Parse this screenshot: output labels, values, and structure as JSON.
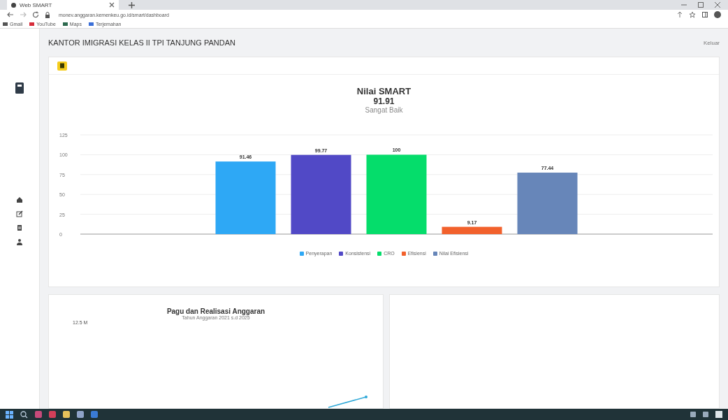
{
  "browser": {
    "tab_title": "Web SMART",
    "url": "monev.anggaran.kemenkeu.go.id/smart/dashboard",
    "bookmarks": [
      "Gmail",
      "YouTube",
      "Maps",
      "Terjemahan"
    ]
  },
  "header": {
    "title": "KANTOR IMIGRASI KELAS II TPI TANJUNG PANDAN",
    "user": "Keluar"
  },
  "smart_card": {
    "score": "91.91",
    "rating": "Sangat Baik",
    "chart_data": {
      "type": "bar",
      "title": "Nilai SMART",
      "ylim": [
        0,
        125
      ],
      "yticks": [
        0,
        25,
        50,
        75,
        100,
        125
      ],
      "data_labels": true,
      "grid": true,
      "series": [
        {
          "name": "Penyerapan",
          "color": "#2ea8f5",
          "values": [
            91.46
          ]
        },
        {
          "name": "Konsistensi",
          "color": "#5149c6",
          "values": [
            99.77
          ]
        },
        {
          "name": "CRO",
          "color": "#05dd6b",
          "values": [
            100
          ]
        },
        {
          "name": "Efisiensi",
          "color": "#f2612c",
          "values": [
            9.17
          ]
        },
        {
          "name": "Nilai Efisiensi",
          "color": "#6786b9",
          "values": [
            77.44
          ]
        }
      ]
    }
  },
  "budget_card": {
    "title": "Pagu dan Realisasi Anggaran",
    "subtitle": "Tahun Anggaran 2021 s.d 2025",
    "y_label": "12.5 M"
  }
}
